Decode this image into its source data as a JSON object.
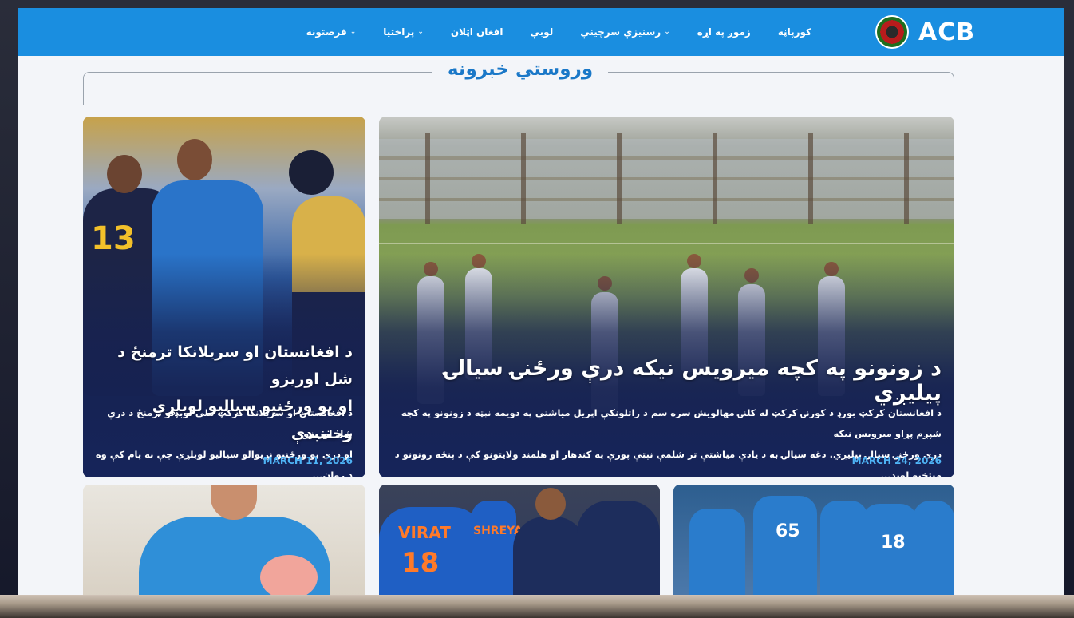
{
  "brand": {
    "name": "ACB"
  },
  "nav": {
    "items": [
      {
        "label": "کورپاڼه",
        "has_caret": false
      },
      {
        "label": "زموږ په اړه",
        "has_caret": false
      },
      {
        "label": "رسنیزې سرچینې",
        "has_caret": true
      },
      {
        "label": "لوبې",
        "has_caret": false
      },
      {
        "label": "افغان اټلان",
        "has_caret": false
      },
      {
        "label": "پراختیا",
        "has_caret": true
      },
      {
        "label": "فرصتونه",
        "has_caret": true
      }
    ]
  },
  "section": {
    "title": "وروستي خبرونه"
  },
  "featured": {
    "title": "د زونونو په کچه میرویس نیکه درې ورځنۍ سیالۍ پیلیږي",
    "excerpt_line1": "د افغانستان کرکټ بورډ د کورنۍ کرکټ له کلنۍ مهالویش سره سم د راتلونکې اپریل میاشتې په دویمه نېټه د زونونو په کچه شپږم پړاو میرویس نیکه",
    "excerpt_line2": "درې ورځنۍ سیالۍ پیلیږي. دغه سیالۍ به د یادې میاشتې تر شلمې نېټې پورې په کندهار او هلمند ولایتونو کې د پنځه زونونو د منتخبو لوبډ...",
    "date": "MARCH 24, 2026",
    "accent": "#4eb3f5"
  },
  "side_story": {
    "title_line1": "د افغانستان او سریلانکا ترمنځ د شل اوریزو",
    "title_line2": "او یو ورځنیو سیالیو لوبلړې وختنبدې",
    "excerpt_line1": "د افغانستان او سریلانکا کرکټ ملي لوبډلو ترمنځ د درې شل اوریزو",
    "excerpt_line2": "او درې یو ورځنیو نړیوالو سیالیو لوبلړې چې به پام کې وه د رواڼ...",
    "date": "MARCH 11, 2026",
    "jersey_number": "13"
  },
  "bottom_row": {
    "card2_text_a": "VIRAT",
    "card2_text_b": "18",
    "card2_text_c": "SHREYA",
    "card3_numbers": [
      "65",
      "18"
    ]
  },
  "colors": {
    "nav_bg": "#1a8ee0",
    "section_title": "#1a78c8",
    "date": "#4eb3f5"
  }
}
